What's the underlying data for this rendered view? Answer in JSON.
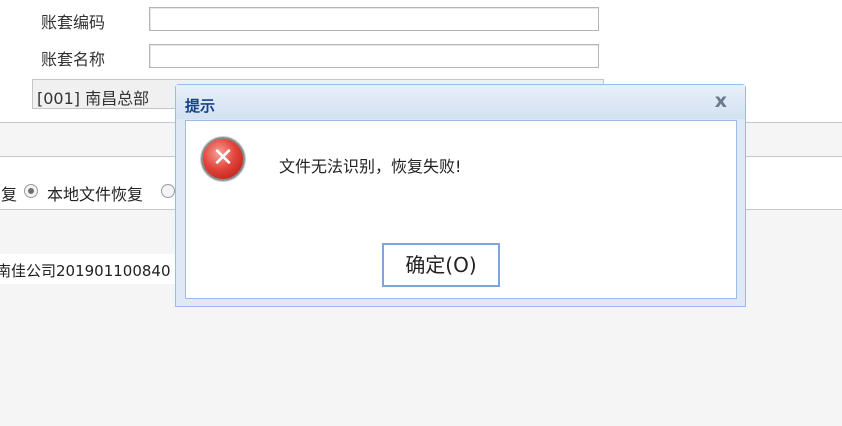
{
  "form": {
    "code_label": "账套编码",
    "name_label": "账套名称",
    "code_value": "",
    "name_value": "",
    "company_selected": "[001] 南昌总部"
  },
  "restore_options": {
    "partial_label": "复",
    "local_file_label": "本地文件恢复",
    "local_file_selected": true,
    "other_selected": false
  },
  "file_row": {
    "filename": "南佳公司201901100840"
  },
  "dialog": {
    "title": "提示",
    "close_glyph": "x",
    "icon": "error-icon",
    "icon_glyph": "✕",
    "message": "文件无法识别，恢复失败!",
    "ok_label": "确定(O)"
  },
  "colors": {
    "dialog_title": "#15428b",
    "dialog_border": "#99bbe8",
    "error_red": "#e2463b",
    "ok_border": "#7fa6dc"
  }
}
